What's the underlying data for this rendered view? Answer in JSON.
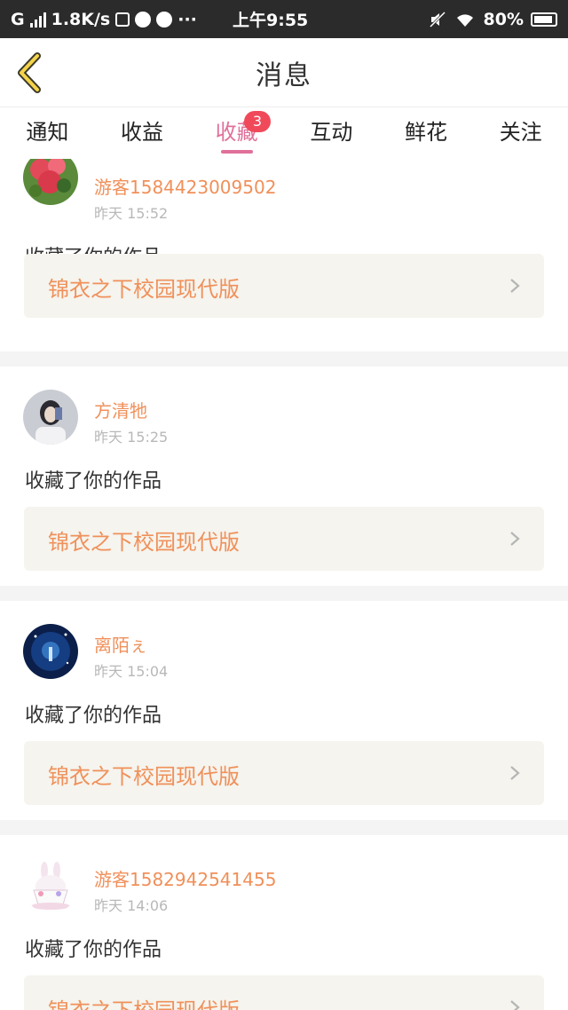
{
  "status_bar": {
    "network": "G",
    "speed": "1.8K/s",
    "dots": "···",
    "time": "上午9:55",
    "battery": "80%"
  },
  "header": {
    "title": "消息"
  },
  "tabs": [
    {
      "label": "通知"
    },
    {
      "label": "收益"
    },
    {
      "label": "收藏",
      "badge": "3",
      "active": true
    },
    {
      "label": "互动"
    },
    {
      "label": "鲜花"
    },
    {
      "label": "关注"
    }
  ],
  "items": [
    {
      "user": "游客1584423009502",
      "time": "昨天 15:52",
      "action": "收藏了你的作品",
      "work": "锦衣之下校园现代版",
      "avatar": "flower-avatar"
    },
    {
      "user": "方清牠",
      "time": "昨天 15:25",
      "action": "收藏了你的作品",
      "work": "锦衣之下校园现代版",
      "avatar": "girl-photo-avatar"
    },
    {
      "user": "离陌ぇ",
      "time": "昨天 15:04",
      "action": "收藏了你的作品",
      "work": "锦衣之下校园现代版",
      "avatar": "night-scene-avatar"
    },
    {
      "user": "游客1582942541455",
      "time": "昨天 14:06",
      "action": "收藏了你的作品",
      "work": "锦衣之下校园现代版",
      "avatar": "bunny-cup-avatar"
    }
  ],
  "colors": {
    "accent": "#e0709a",
    "badge": "#f04a5a",
    "username": "#f0905a",
    "work_box_bg": "#f5f4ee"
  }
}
